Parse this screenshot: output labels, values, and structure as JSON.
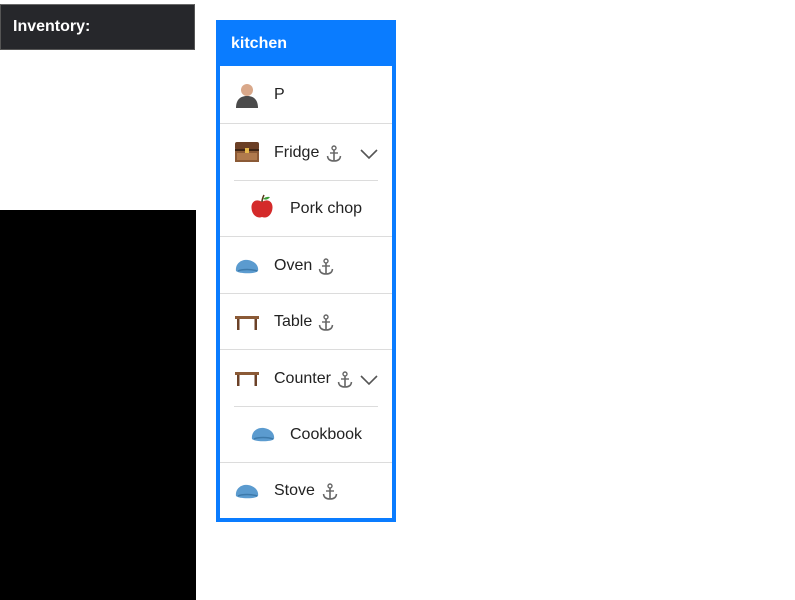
{
  "inventory": {
    "title": "Inventory:"
  },
  "room": {
    "title": "kitchen",
    "accent": "#0a7cff",
    "items": [
      {
        "label": "P",
        "icon": "person-icon",
        "anchored": false,
        "expandable": false,
        "level": 0
      },
      {
        "label": "Fridge",
        "icon": "chest-icon",
        "anchored": true,
        "expandable": true,
        "level": 0
      },
      {
        "label": "Pork chop",
        "icon": "apple-icon",
        "anchored": false,
        "expandable": false,
        "level": 1
      },
      {
        "label": "Oven",
        "icon": "blob-icon",
        "anchored": true,
        "expandable": false,
        "level": 0
      },
      {
        "label": "Table",
        "icon": "table-icon",
        "anchored": true,
        "expandable": false,
        "level": 0
      },
      {
        "label": "Counter",
        "icon": "table-icon",
        "anchored": true,
        "expandable": true,
        "level": 0
      },
      {
        "label": "Cookbook",
        "icon": "blob-icon",
        "anchored": false,
        "expandable": false,
        "level": 1
      },
      {
        "label": "Stove",
        "icon": "blob-icon",
        "anchored": true,
        "expandable": false,
        "level": 0
      }
    ]
  }
}
